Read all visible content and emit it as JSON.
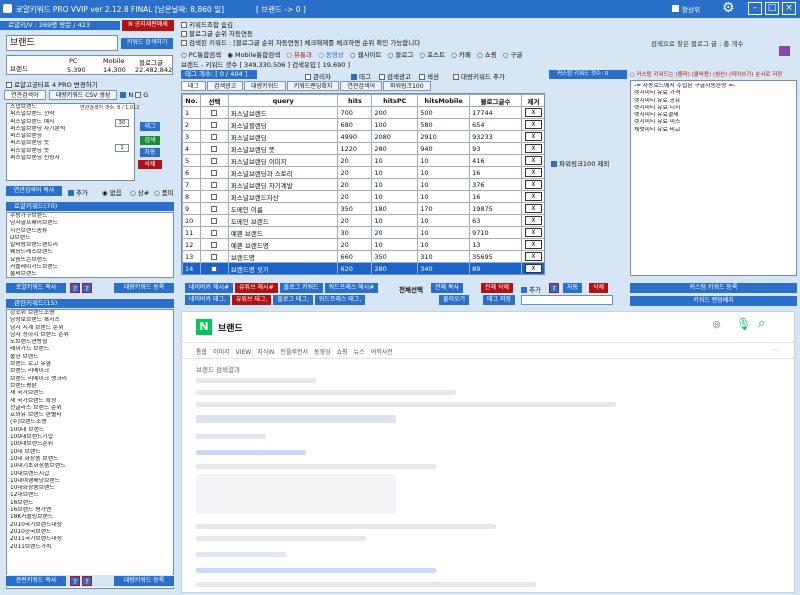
{
  "app": {
    "title": "로얄키워드 PRO VVIP ver 2.12.8 FINAL [남은날짜: 8,860 일]",
    "room": "[ 브랜드 -> 0 ]",
    "always_on_top": "항상위"
  },
  "left": {
    "user_info": "로얄키/V : 269명 방문 / 423",
    "gongji": "N 공지재판매세",
    "search_value": "브랜드",
    "search_btn": "키워드 검색하기",
    "stats": {
      "col1": "브랜드",
      "pc_label": "PC",
      "pc_val": "5,390",
      "mob_label": "Mobile",
      "mob_val": "14,300",
      "total_label": "블로그글",
      "total_val": "22,482,842"
    },
    "pro_check": "로얄고궁터프 4 PRO 변경하기",
    "tab_csv": "연관검색어",
    "tab_csv2": "대량키워드 CSV 생성",
    "n_label": "N",
    "g_label": "G",
    "small_list": [
      "스냅브랜드",
      "퍼스널브랜드 전략",
      "퍼스널브랜드 예시",
      "퍼스널브랜딩 자기분석",
      "퍼스널브랜딩",
      "퍼스널브랜딩 뜻",
      "퍼스널브랜딩 뜻",
      "퍼스널브랜딩 신청자"
    ],
    "ratio": "연관검색어 갯수: 8 / 1,012",
    "num1": "30",
    "num2": "1",
    "b_tag": "태그",
    "b_search": "검색",
    "b_auto": "자동",
    "b_del": "삭제",
    "copy_btn": "연관검색어 복사",
    "add": "추가",
    "opt1": "없음",
    "opt2": "상#",
    "opt3": "품미",
    "hot_hdr": "로얄키워드(70)",
    "hot_list": [
      "주방가구브랜드",
      "남자골프웨어브랜드",
      "지진브랜드종류",
      "D브랜드",
      "칼바람브랜드팬트리",
      "웨딩드레스브랜드",
      "요즘뜨는브랜드",
      "커플레이가드브랜드",
      "홈비브랜드"
    ],
    "hot_copy": "로얄키워드 복사",
    "hot_reg": "대량키워드 등록",
    "rel_hdr": "관련키워드(15)",
    "rel_list": [
      "강소위 브랜드조명",
      "남성보브랜드 복지스",
      "남자 시계 브랜드 순위",
      "남자 정하지 브랜드 순위",
      "노브랜드연방점",
      "레이가드 브랜드",
      "볼헌 브랜드",
      "브랜드 로고 유형",
      "브랜드 리메이크",
      "브랜드 리메이크 랭크리",
      "브랜드평판",
      "새 국가브랜드",
      "새 국가브랜드 확정",
      "선글라스 브랜드 순위",
      "호와유 브랜드 판별티",
      "(주)브랜드조명",
      "100대 브랜드",
      "100대브랜드기업",
      "100대브랜드순위",
      "10대 브랜드",
      "10대 화장품 브랜드",
      "10대기초화장품브랜드",
      "10대브랜드지갑",
      "10대여행배낭브랜드",
      "10대화장품브랜드",
      "12대브랜드",
      "16브랜드",
      "16브랜드 평가엔",
      "18K커플링브랜드",
      "2010국가브랜드대상",
      "2010한국브랜드",
      "2011국가브랜드대상",
      "2011브랜드가치"
    ],
    "rel_copy": "관련키워드 복사",
    "rel_reg": "대량키워드 등록"
  },
  "top": {
    "c1": "키워드조합 숨김",
    "c2": "블로그글 순위 자동연동",
    "c3": "검색된 키워드 : [블로그글 순위 자동연동] 체크해제를 체크하면 순위 확인 가능합니다",
    "found": "검색으로 찾은 블로그 글 : 총 개수",
    "r1": "PC통합검색",
    "r2": "Mobile통합검색",
    "r3": "뷰통과",
    "r4": "동영상",
    "r5": "웹사이트",
    "r6": "블로그",
    "r7": "포스트",
    "r8": "카페",
    "r9": "쇼핑",
    "r10": "구글",
    "info": "브랜드 - 키워드 갯수 [ 349,330,506 ]  검색유입 [ 19,690 ]"
  },
  "mid": {
    "tag_count": "태그 개수: [ 0 / 404 ]",
    "opt_admin": "관리자",
    "opt_tag": "태그",
    "opt_search": "검색광고",
    "opt_rand": "색션",
    "opt_bulk": "대량키워드 추가",
    "custom_count": "커스텀 키워드 갯수: 0",
    "tabs": [
      "태그",
      "검색광고",
      "대량키워드",
      "키워드랜딩확지",
      "연관검색어",
      "파워링크100"
    ],
    "headers": [
      "No.",
      "선택",
      "query",
      "hits",
      "hitsPC",
      "hitsMobile",
      "블로그글수",
      "제거"
    ],
    "rows": [
      {
        "no": "1",
        "q": "퍼스널브랜드",
        "h": "700",
        "pc": "200",
        "m": "500",
        "b": "17744"
      },
      {
        "no": "2",
        "q": "퍼스널블랜딩",
        "h": "680",
        "pc": "100",
        "m": "580",
        "b": "654"
      },
      {
        "no": "3",
        "q": "퍼스널브랜딩",
        "h": "4990",
        "pc": "2080",
        "m": "2910",
        "b": "93233"
      },
      {
        "no": "4",
        "q": "퍼스널브랜딩 뜻",
        "h": "1220",
        "pc": "280",
        "m": "940",
        "b": "93"
      },
      {
        "no": "5",
        "q": "퍼스널브랜딩 이미지",
        "h": "20",
        "pc": "10",
        "m": "10",
        "b": "416"
      },
      {
        "no": "6",
        "q": "퍼스널브랜딩과 스토리",
        "h": "20",
        "pc": "10",
        "m": "10",
        "b": "16"
      },
      {
        "no": "7",
        "q": "퍼스널브랜딩 자기계발",
        "h": "20",
        "pc": "10",
        "m": "10",
        "b": "376"
      },
      {
        "no": "8",
        "q": "퍼스널브랜드자산",
        "h": "20",
        "pc": "10",
        "m": "10",
        "b": "16"
      },
      {
        "no": "9",
        "q": "도메인 이름",
        "h": "350",
        "pc": "180",
        "m": "170",
        "b": "19875"
      },
      {
        "no": "10",
        "q": "도메인 브랜드",
        "h": "20",
        "pc": "10",
        "m": "10",
        "b": "63"
      },
      {
        "no": "11",
        "q": "예쁜 브랜드",
        "h": "30",
        "pc": "20",
        "m": "10",
        "b": "9710"
      },
      {
        "no": "12",
        "q": "예쁜 브랜드명",
        "h": "20",
        "pc": "10",
        "m": "10",
        "b": "13"
      },
      {
        "no": "13",
        "q": "브랜드명",
        "h": "660",
        "pc": "350",
        "m": "310",
        "b": "35695"
      },
      {
        "no": "14",
        "q": "브랜드명 짓기",
        "h": "620",
        "pc": "280",
        "m": "340",
        "b": "89"
      }
    ],
    "x": "X",
    "powerlink": "파워링크100 제외",
    "actions1": [
      "네이버카 해시#",
      "유튜브 해시#",
      "블로그 키워드",
      "워드프레스 해시#"
    ],
    "actions2": [
      "네이버카 태그,",
      "유튜브 태그,",
      "블로그 태그,",
      "워드프레스 태그,"
    ],
    "sel_all": "전체선택",
    "copy_all": "전체 복사",
    "del_all": "전체 삭제",
    "add": "추가",
    "auto": "자동",
    "del": "삭제",
    "load": "불러오기",
    "save": "태그 저장"
  },
  "right": {
    "hdr": "○ 커스텀 키워드는 (줌마) (쿨바용) (쉼산) (띄어쓰기) 순서로 저장",
    "list": [
      "-= 자동로드에서 수집된 구글자동완성 =-",
      "렛지피티 유료 가격",
      "렛지피티 유료 공유",
      "렛지피티 유료 디시",
      "렛지피티 유료결제",
      "렛지피티 유료 피스",
      "체럿피티 유료 비교"
    ],
    "btn1": "커스텀 키워드 등록",
    "btn2": "키워드 랜덤배치"
  },
  "browser": {
    "logo": "N",
    "query": "브랜드",
    "nav": [
      "통합",
      "이미지",
      "VIEW",
      "지식iN",
      "인플루언서",
      "동영상",
      "쇼핑",
      "뉴스",
      "어학사전"
    ],
    "section": "브랜드 검색결과"
  },
  "colors": {
    "accent": "#2a6fc9",
    "danger": "#b31212",
    "naver": "#03c75a"
  }
}
